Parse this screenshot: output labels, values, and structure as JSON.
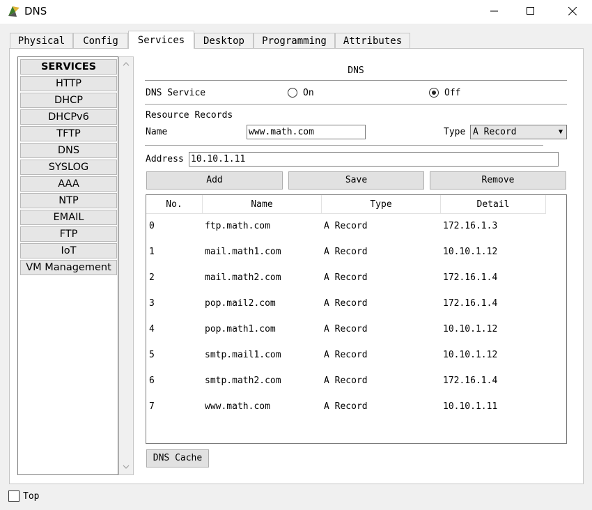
{
  "window": {
    "title": "DNS",
    "minimize": "—",
    "maximize": "☐",
    "close": "✕"
  },
  "tabs": [
    "Physical",
    "Config",
    "Services",
    "Desktop",
    "Programming",
    "Attributes"
  ],
  "active_tab": "Services",
  "services": {
    "header": "SERVICES",
    "items": [
      "HTTP",
      "DHCP",
      "DHCPv6",
      "TFTP",
      "DNS",
      "SYSLOG",
      "AAA",
      "NTP",
      "EMAIL",
      "FTP",
      "IoT",
      "VM Management"
    ]
  },
  "dns": {
    "title": "DNS",
    "service_label": "DNS Service",
    "on_label": "On",
    "off_label": "Off",
    "service_state": "Off",
    "resource_records_label": "Resource Records",
    "name_label": "Name",
    "name_value": "www.math.com",
    "type_label": "Type",
    "type_value": "A Record",
    "address_label": "Address",
    "address_value": "10.10.1.11",
    "buttons": {
      "add": "Add",
      "save": "Save",
      "remove": "Remove"
    },
    "table": {
      "headers": [
        "No.",
        "Name",
        "Type",
        "Detail"
      ],
      "rows": [
        [
          "0",
          "ftp.math.com",
          "A Record",
          "172.16.1.3"
        ],
        [
          "1",
          "mail.math1.com",
          "A Record",
          "10.10.1.12"
        ],
        [
          "2",
          "mail.math2.com",
          "A Record",
          "172.16.1.4"
        ],
        [
          "3",
          "pop.mail2.com",
          "A Record",
          "172.16.1.4"
        ],
        [
          "4",
          "pop.math1.com",
          "A Record",
          "10.10.1.12"
        ],
        [
          "5",
          "smtp.mail1.com",
          "A Record",
          "10.10.1.12"
        ],
        [
          "6",
          "smtp.math2.com",
          "A Record",
          "172.16.1.4"
        ],
        [
          "7",
          "www.math.com",
          "A Record",
          "10.10.1.11"
        ]
      ]
    },
    "cache_button": "DNS Cache"
  },
  "footer": {
    "top_label": "Top",
    "top_checked": false
  }
}
